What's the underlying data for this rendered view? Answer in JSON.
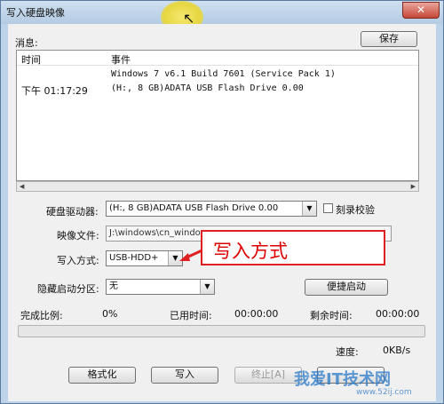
{
  "window": {
    "title": "写入硬盘映像",
    "close": "✕"
  },
  "messages": {
    "label": "消息:",
    "save_button": "保存",
    "columns": {
      "time": "时间",
      "event": "事件"
    },
    "rows": [
      {
        "time": "",
        "event": "Windows 7 v6.1 Build 7601 (Service Pack 1)"
      },
      {
        "time": "下午 01:17:29",
        "event": "(H:, 8 GB)ADATA   USB Flash Drive 0.00"
      }
    ]
  },
  "form": {
    "drive_label": "硬盘驱动器:",
    "drive_value": "(H:, 8 GB)ADATA   USB Flash Drive 0.00",
    "verify_label": "刻录校验",
    "image_label": "映像文件:",
    "image_value": "J:\\windows\\cn_window",
    "write_method_label": "写入方式:",
    "write_method_value": "USB-HDD+",
    "hidden_partition_label": "隐藏启动分区:",
    "hidden_partition_value": "无",
    "quick_boot_button": "便捷启动"
  },
  "status": {
    "complete_label": "完成比例:",
    "complete_value": "0%",
    "elapsed_label": "已用时间:",
    "elapsed_value": "00:00:00",
    "remaining_label": "剩余时间:",
    "remaining_value": "00:00:00",
    "progress": 0,
    "speed_label": "速度:",
    "speed_value": "0KB/s"
  },
  "buttons": {
    "format": "格式化",
    "write": "写入",
    "stop": "终止[A]"
  },
  "annotation": {
    "callout_text": "写入方式"
  },
  "watermark": {
    "text": "我爱IT技术网",
    "url": "www.52ij.com"
  },
  "colors": {
    "accent_red": "#e02020",
    "progress_green": "#3bb33b"
  }
}
